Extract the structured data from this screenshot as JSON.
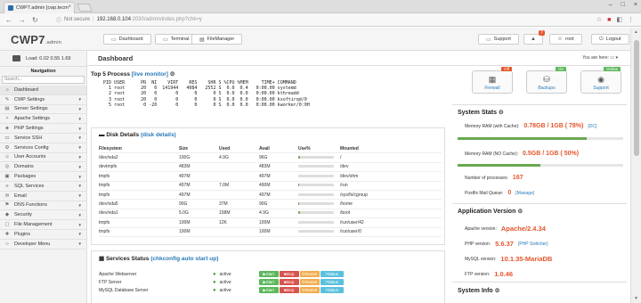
{
  "browser": {
    "tab_title": "CWP7.admin [cwp.tecm",
    "url_security": "Not secure",
    "url_host": "192.168.0.104",
    "url_path": ":2030/admin/index.php?chk=y"
  },
  "header": {
    "logo": "CWP7",
    "logo_sub": ".admin",
    "btn_dashboard": "Dashboard",
    "btn_terminal": "Terminal",
    "btn_filemanager": "FileManager",
    "btn_support": "Support",
    "notif_count": "7",
    "btn_user": "root",
    "btn_logout": "Logout"
  },
  "sidebar": {
    "load": "Load: 0.02  0.55  1.69",
    "nav_title": "Navigation",
    "search_placeholder": "Search...",
    "items": [
      {
        "label": "Dashboard",
        "icon": "home-icon",
        "g": "⌂"
      },
      {
        "label": "CWP Settings",
        "icon": "wrench-icon",
        "g": "✎"
      },
      {
        "label": "Server Settings",
        "icon": "server-icon",
        "g": "▤"
      },
      {
        "label": "Apache Settings",
        "icon": "feather-icon",
        "g": "✧"
      },
      {
        "label": "PHP Settings",
        "icon": "php-icon",
        "g": "◈"
      },
      {
        "label": "Service SSH",
        "icon": "terminal-icon",
        "g": "▭"
      },
      {
        "label": "Services Config",
        "icon": "gear-icon",
        "g": "⚙"
      },
      {
        "label": "User Accounts",
        "icon": "user-icon",
        "g": "☺"
      },
      {
        "label": "Domains",
        "icon": "globe-icon",
        "g": "◎"
      },
      {
        "label": "Packages",
        "icon": "package-icon",
        "g": "▣"
      },
      {
        "label": "SQL Services",
        "icon": "database-icon",
        "g": "≡"
      },
      {
        "label": "Email",
        "icon": "envelope-icon",
        "g": "✉"
      },
      {
        "label": "DNS Functions",
        "icon": "dns-icon",
        "g": "⚑"
      },
      {
        "label": "Security",
        "icon": "shield-icon",
        "g": "◆"
      },
      {
        "label": "File Management",
        "icon": "folder-icon",
        "g": "▢"
      },
      {
        "label": "Plugins",
        "icon": "plug-icon",
        "g": "✚"
      },
      {
        "label": "Developer Menu",
        "icon": "code-icon",
        "g": "‹›"
      }
    ]
  },
  "main": {
    "title": "Dashboard",
    "you_are_here": "You are here:",
    "top5_title": "Top 5 Process",
    "top5_link": "[live monitor]",
    "top5_text": "  PID USER      PR  NI    VIRT    RES    SHR S %CPU %MEM     TIME+ COMMAND\n    1 root      20   0  141944   4084   2552 S  0.0  0.4   0:00.00 systemd\n    2 root      20   0       0      0      0 S  0.0  0.0   0:00.00 kthreadd\n    3 root      20   0       0      0      0 S  0.0  0.0   0:00.00 ksoftirqd/0\n    5 root       0 -20       0      0      0 S  0.0  0.0   0:00.00 kworker/0:0H",
    "disk_title": "Disk Details",
    "disk_link": "(disk details)",
    "disk_headers": [
      "Filesystem",
      "Size",
      "Used",
      "Avail",
      "Use%",
      "Mounted"
    ],
    "disk_rows": [
      {
        "fs": "/dev/sda2",
        "size": "100G",
        "used": "4.9G",
        "avail": "96G",
        "pct": 5,
        "mount": "/"
      },
      {
        "fs": "devtmpfs",
        "size": "483M",
        "used": "",
        "avail": "483M",
        "pct": 0,
        "mount": "/dev"
      },
      {
        "fs": "tmpfs",
        "size": "497M",
        "used": "",
        "avail": "497M",
        "pct": 0,
        "mount": "/dev/shm"
      },
      {
        "fs": "tmpfs",
        "size": "497M",
        "used": "7.0M",
        "avail": "490M",
        "pct": 2,
        "mount": "/run"
      },
      {
        "fs": "tmpfs",
        "size": "497M",
        "used": "",
        "avail": "497M",
        "pct": 0,
        "mount": "/sys/fs/cgroup"
      },
      {
        "fs": "/dev/sda5",
        "size": "90G",
        "used": "37M",
        "avail": "90G",
        "pct": 1,
        "mount": "/home"
      },
      {
        "fs": "/dev/sda1",
        "size": "5.0G",
        "used": "158M",
        "avail": "4.9G",
        "pct": 4,
        "mount": "/boot"
      },
      {
        "fs": "tmpfs",
        "size": "100M",
        "used": "12K",
        "avail": "100M",
        "pct": 0,
        "mount": "/run/user/42"
      },
      {
        "fs": "tmpfs",
        "size": "100M",
        "used": "",
        "avail": "100M",
        "pct": 0,
        "mount": "/run/user/0"
      }
    ],
    "services_title": "Services Status",
    "services_link": "(chkconfig auto start up)",
    "services": [
      {
        "name": "Apache Webserver",
        "status": "active"
      },
      {
        "name": "FTP Server",
        "status": "active"
      },
      {
        "name": "MySQL Database Server",
        "status": "active"
      }
    ],
    "svc_buttons": {
      "start": "Start",
      "stop": "Stop",
      "restart": "Restart",
      "status": "Status"
    }
  },
  "right": {
    "quick": [
      {
        "label": "Firewall",
        "tag": "Off",
        "tagclass": "off",
        "icon": "firewall-icon",
        "g": "▦"
      },
      {
        "label": "Backups",
        "tag": "On",
        "tagclass": "on",
        "icon": "backup-icon",
        "g": "⛁"
      },
      {
        "label": "Support",
        "tag": "Online",
        "tagclass": "on",
        "icon": "lifebuoy-icon",
        "g": "◉"
      }
    ],
    "system_stats_title": "System Stats",
    "ram_cache_label": "Memory RAM (with Cache):",
    "ram_cache_value": "0.78GB / 1GB ( 78%)",
    "ram_cache_pct": 78,
    "ram_cache_link": "[DC]",
    "ram_nocache_label": "Memory RAM (NO Cache):",
    "ram_nocache_value": "0.5GB / 1GB ( 50%)",
    "ram_nocache_pct": 50,
    "processes_label": "Number of processes:",
    "processes_value": "167",
    "mailqueue_label": "Postfix Mail Queue:",
    "mailqueue_value": "0",
    "mailqueue_link": "[Manage]",
    "appver_title": "Application Version",
    "apache_label": "Apache version:",
    "apache_value": "Apache/2.4.34",
    "php_label": "PHP version:",
    "php_value": "5.6.37",
    "php_link": "[PHP Switcher]",
    "mysql_label": "MySQL version:",
    "mysql_value": "10.1.35-MariaDB",
    "ftp_label": "FTP version:",
    "ftp_value": "1.0.46",
    "sysinfo_title": "System Info"
  }
}
